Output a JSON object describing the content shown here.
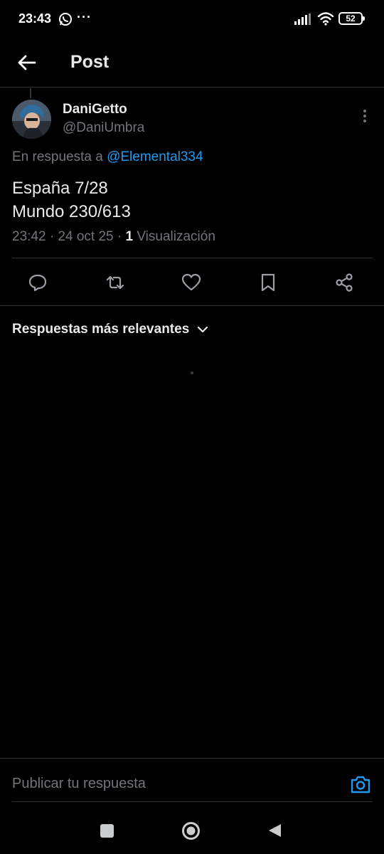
{
  "status_bar": {
    "time": "23:43",
    "dots": "···",
    "battery": "52"
  },
  "header": {
    "title": "Post"
  },
  "post": {
    "author_name": "DaniGetto",
    "author_handle": "@DaniUmbra",
    "reply_prefix": "En respuesta a ",
    "reply_mention": "@Elemental334",
    "text_line1": "España 7/28",
    "text_line2": "Mundo 230/613",
    "meta_time_date": "23:42 · 24 oct 25 · ",
    "views_count": "1",
    "views_label": " Visualización"
  },
  "actions": {
    "icons": [
      "reply-icon",
      "repost-icon",
      "like-icon",
      "bookmark-icon",
      "share-icon"
    ]
  },
  "replies": {
    "sort_label": "Respuestas más relevantes"
  },
  "compose": {
    "placeholder": "Publicar tu respuesta"
  },
  "colors": {
    "background": "#000000",
    "accent": "#1d9bf0",
    "text_primary": "#e7e9ea",
    "text_secondary": "#71767b",
    "divider": "#2f3336"
  }
}
